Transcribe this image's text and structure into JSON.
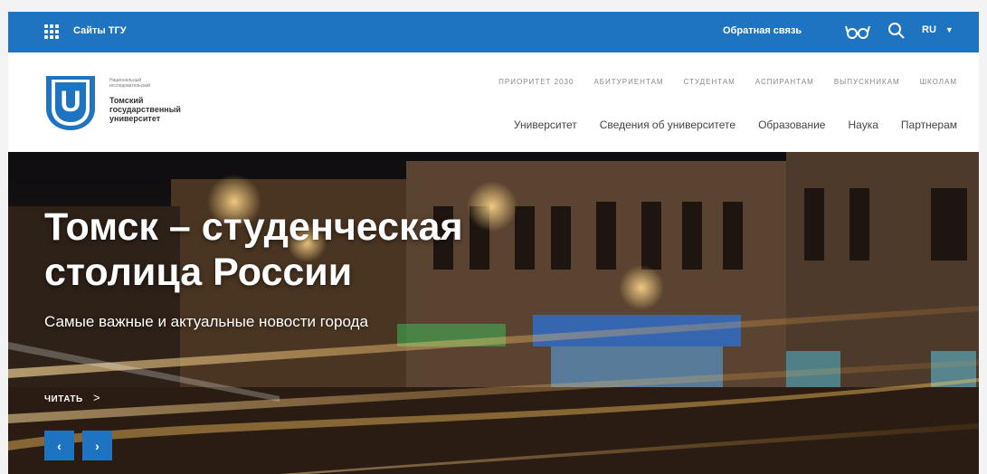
{
  "topbar": {
    "sites_label": "Сайты ТГУ",
    "feedback_label": "Обратная связь",
    "language": "RU"
  },
  "logo": {
    "small_text": "Национальный исследовательский",
    "name": "Томский государственный университет",
    "letter": "U"
  },
  "sub_nav": [
    "ПРИОРИТЕТ 2030",
    "АБИТУРИЕНТАМ",
    "СТУДЕНТАМ",
    "АСПИРАНТАМ",
    "ВЫПУСКНИКАМ",
    "ШКОЛАМ"
  ],
  "main_nav": [
    "Университет",
    "Сведения об университете",
    "Образование",
    "Наука",
    "Партнерам"
  ],
  "hero": {
    "title": "Томск – студенческая столица России",
    "subtitle": "Самые важные и актуальные новости города",
    "read_more": "ЧИТАТЬ",
    "read_more_arrow": ">",
    "prev": "‹",
    "next": "›"
  },
  "colors": {
    "brand_blue": "#1f74c1",
    "hero_dark": "#1b1410",
    "street_light": "#f2a23a"
  }
}
